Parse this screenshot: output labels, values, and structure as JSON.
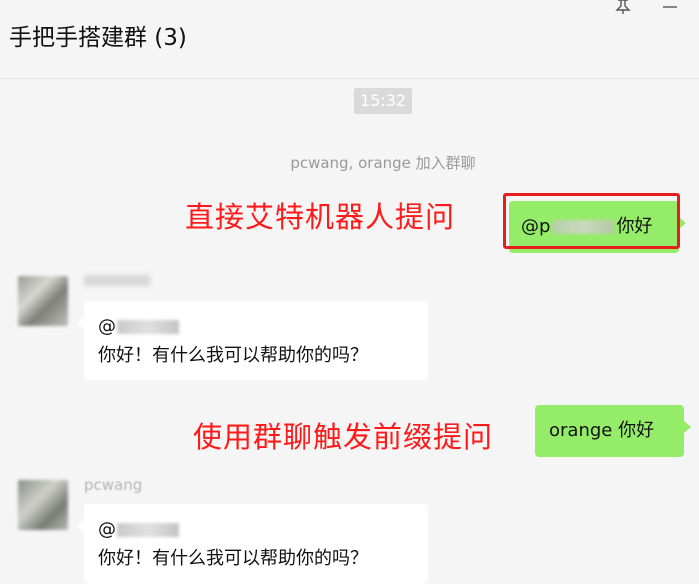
{
  "window": {
    "title": "手把手搭建群 (3)",
    "pin_icon": "pin-icon",
    "minimize_icon": "minimize-icon"
  },
  "chat": {
    "timestamp": "15:32",
    "system_message": "pcwang, orange 加入群聊",
    "annotations": {
      "first": "直接艾特机器人提问",
      "second": "使用群聊触发前缀提问"
    },
    "messages": [
      {
        "direction": "outgoing",
        "mention_prefix": "@p",
        "text": "你好"
      },
      {
        "direction": "incoming",
        "sender": "",
        "mention_prefix": "@",
        "text": "你好！有什么我可以帮助你的吗？"
      },
      {
        "direction": "outgoing",
        "text": "orange 你好"
      },
      {
        "direction": "incoming",
        "sender": "pcwang",
        "mention_prefix": "@",
        "text": "你好！有什么我可以帮助你的吗？"
      }
    ]
  },
  "colors": {
    "background": "#f5f5f5",
    "outgoing_bubble": "#95ec69",
    "incoming_bubble": "#ffffff",
    "annotation_red": "#ff1a1a",
    "highlight_border": "#e61e1e"
  }
}
